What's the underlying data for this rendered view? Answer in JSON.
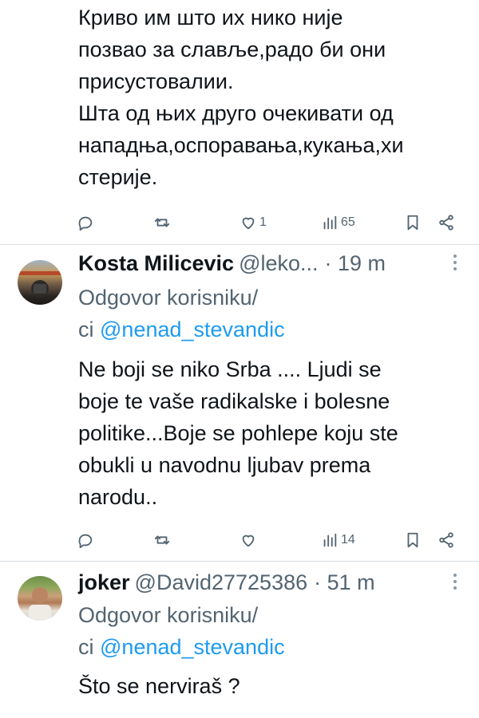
{
  "tweets": [
    {
      "text_lines": [
        "Криво им што их нико није",
        "позвао за славље,радо би они",
        "присустовалии.",
        "Шта од њих друго очекивати од",
        "нападња,оспоравања,кукања,хи",
        "стерије."
      ],
      "actions": {
        "reply_count": "",
        "retweet_count": "",
        "like_count": "1",
        "views_count": "65"
      }
    },
    {
      "name": "Kosta Milicevic",
      "handle": "@leko...",
      "time": "· 19 m",
      "reply_prefix": "Odgovor korisniku/",
      "reply_ci": "ci",
      "reply_mention": "@nenad_stevandic",
      "text_lines": [
        "Ne boji se niko Srba .... Ljudi se",
        "boje te vaše radikalske i bolesne",
        "politike...Boje se pohlepe koju ste",
        "obukli u navodnu ljubav prema",
        "narodu.."
      ],
      "actions": {
        "reply_count": "",
        "retweet_count": "",
        "like_count": "",
        "views_count": "14"
      }
    },
    {
      "name": "joker",
      "handle": "@David27725386",
      "time": "· 51 m",
      "reply_prefix": "Odgovor korisniku/",
      "reply_ci": "ci",
      "reply_mention": "@nenad_stevandic",
      "text_lines": [
        "Što se nerviraš ?"
      ]
    }
  ],
  "icons": [
    "reply-icon",
    "retweet-icon",
    "like-icon",
    "views-icon",
    "bookmark-icon",
    "share-icon",
    "more-icon"
  ],
  "colors": {
    "text": "#0f1419",
    "secondary": "#536471",
    "link": "#1d9bf0",
    "divider": "#d7dde2"
  }
}
